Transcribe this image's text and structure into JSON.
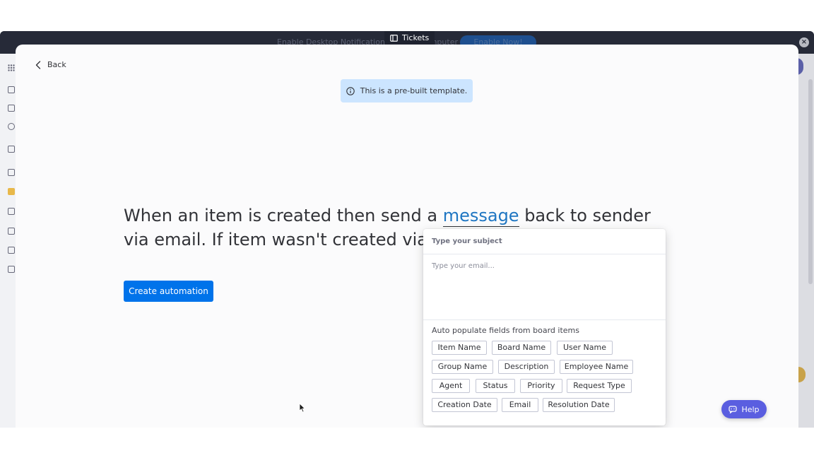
{
  "app_chrome": {
    "notification_text": "Enable Desktop Notifications on this computer",
    "notification_button": "Enable Now!",
    "tab_title": "Tickets"
  },
  "modal": {
    "back_label": "Back",
    "banner_text": "This is a pre-built template.",
    "sentence": {
      "before": "When an item is created then send a ",
      "link": "message",
      "after": " back to sender via email. If item wasn't created via email"
    },
    "create_button": "Create automation"
  },
  "email_popup": {
    "subject_placeholder": "Type your subject",
    "body_placeholder": "Type your email...",
    "autopopulate_label": "Auto populate fields from board items",
    "fields": [
      "Item Name",
      "Board Name",
      "User Name",
      "Group Name",
      "Description",
      "Employee Name",
      "Agent",
      "Status",
      "Priority",
      "Request Type",
      "Creation Date",
      "Email",
      "Resolution Date"
    ]
  },
  "help": {
    "label": "Help"
  },
  "colors": {
    "primary": "#0073ea",
    "banner_bg": "#cce5ff",
    "link": "#1f76c2",
    "help_bg": "#5a5ee0"
  }
}
